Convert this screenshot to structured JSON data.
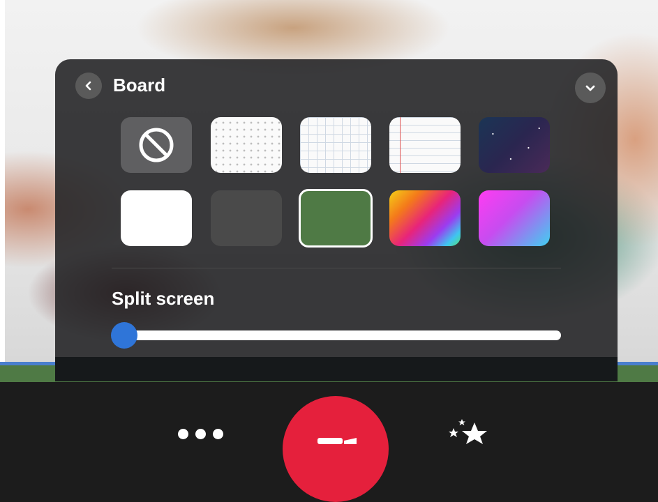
{
  "panel": {
    "title": "Board",
    "split_screen_label": "Split screen",
    "split_screen_value": 0
  },
  "backgrounds": [
    {
      "id": "none",
      "icon": "no-background-icon",
      "selected": false
    },
    {
      "id": "dot-grid",
      "selected": false
    },
    {
      "id": "square-grid",
      "selected": false
    },
    {
      "id": "lined-paper",
      "selected": false
    },
    {
      "id": "night-sky",
      "selected": false
    },
    {
      "id": "white",
      "color": "#ffffff",
      "selected": false
    },
    {
      "id": "dark-gray",
      "color": "#4a4a4a",
      "selected": false
    },
    {
      "id": "green",
      "color": "#4f7a45",
      "selected": true
    },
    {
      "id": "rainbow",
      "selected": false
    },
    {
      "id": "pink-blue",
      "selected": false
    }
  ],
  "colors": {
    "accent": "#2f75d8",
    "record": "#e5203c",
    "panel": "#262628",
    "selected_border": "#ffffff"
  },
  "toolbar": {
    "more_icon": "more-dots-icon",
    "record_icon": "camera-icon",
    "effects_icon": "sparkle-stars-icon"
  }
}
